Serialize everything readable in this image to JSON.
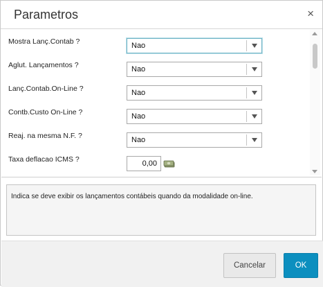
{
  "dialog": {
    "title": "Parametros",
    "close_symbol": "×"
  },
  "params": [
    {
      "label": "Mostra Lanç.Contab ?",
      "value": "Nao",
      "type": "select"
    },
    {
      "label": "Aglut. Lançamentos ?",
      "value": "Nao",
      "type": "select"
    },
    {
      "label": "Lanç.Contab.On-Line ?",
      "value": "Nao",
      "type": "select"
    },
    {
      "label": "Contb.Custo On-Line ?",
      "value": "Nao",
      "type": "select"
    },
    {
      "label": "Reaj. na mesma N.F. ?",
      "value": "Nao",
      "type": "select"
    },
    {
      "label": "Taxa deflacao ICMS ?",
      "value": "0,00",
      "type": "number",
      "icon": "money-icon"
    }
  ],
  "help": {
    "text": "Indica se deve exibir os lançamentos contábeis quando da modalidade on-line."
  },
  "footer": {
    "cancel_label": "Cancelar",
    "ok_label": "OK"
  },
  "colors": {
    "accent": "#0c8fbf",
    "focus_border": "#6cb2c4"
  }
}
